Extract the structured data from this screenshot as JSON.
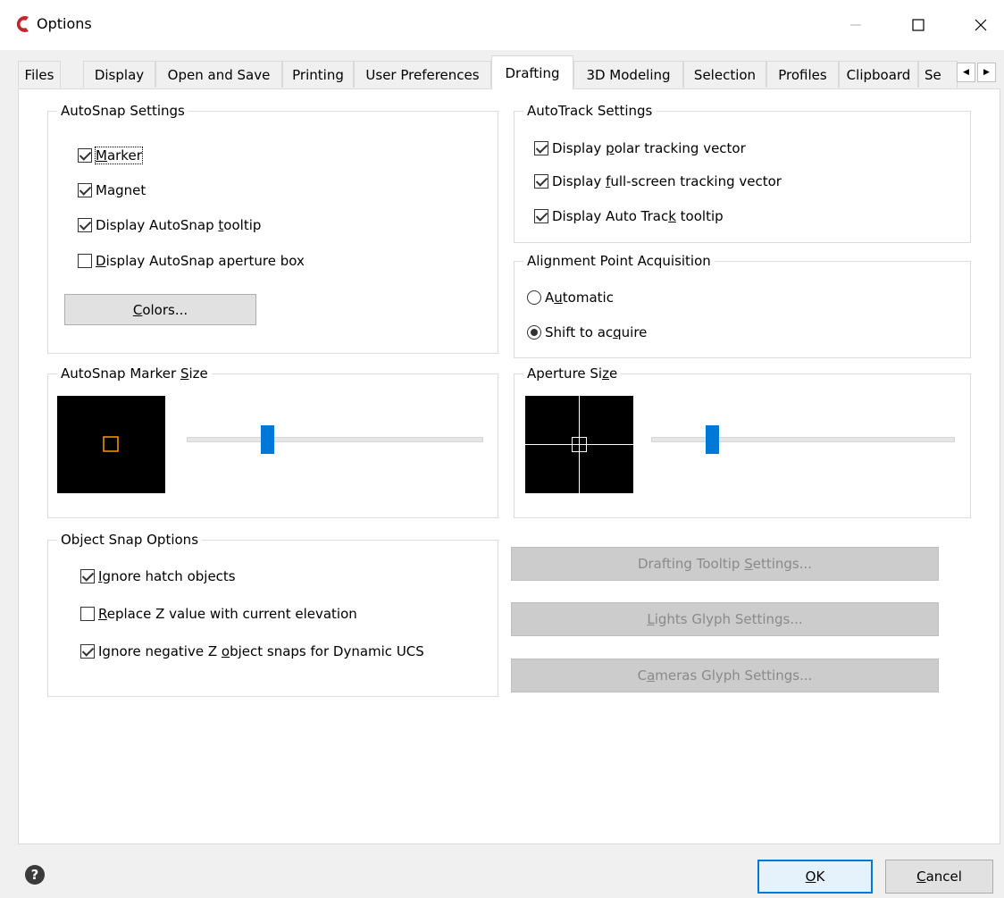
{
  "window": {
    "title": "Options",
    "minimize_icon": "minimize-icon",
    "maximize_icon": "maximize-icon",
    "close_icon": "close-icon"
  },
  "tabs": [
    {
      "label": "Files"
    },
    {
      "label": "Display"
    },
    {
      "label": "Open and Save"
    },
    {
      "label": "Printing"
    },
    {
      "label": "User Preferences"
    },
    {
      "label": "Drafting",
      "active": true
    },
    {
      "label": "3D Modeling"
    },
    {
      "label": "Selection"
    },
    {
      "label": "Profiles"
    },
    {
      "label": "Clipboard"
    },
    {
      "label": "Se"
    }
  ],
  "autosnap": {
    "title": "AutoSnap Settings",
    "marker": {
      "pre": "",
      "u": "M",
      "post": "arker",
      "checked": true
    },
    "magnet": {
      "pre": "Ma",
      "u": "g",
      "post": "net",
      "checked": true
    },
    "tooltip": {
      "pre": "Display AutoSnap ",
      "u": "t",
      "post": "ooltip",
      "checked": true
    },
    "aperture": {
      "pre": "",
      "u": "D",
      "post": "isplay AutoSnap aperture box",
      "checked": false
    },
    "colors_button": {
      "pre": "",
      "u": "C",
      "post": "olors..."
    }
  },
  "autotrack": {
    "title": "AutoTrack Settings",
    "polar": {
      "pre": "Display ",
      "u": "p",
      "post": "olar tracking vector",
      "checked": true
    },
    "fullscreen": {
      "pre": "Display ",
      "u": "f",
      "post": "ull-screen tracking vector",
      "checked": true
    },
    "tooltip": {
      "pre": "Display Auto Trac",
      "u": "k",
      "post": " tooltip",
      "checked": true
    }
  },
  "alignment": {
    "title": "Alignment Point Acquisition",
    "automatic": {
      "pre": "A",
      "u": "u",
      "post": "tomatic",
      "checked": false
    },
    "shift": {
      "pre": "Shift to ac",
      "u": "q",
      "post": "uire",
      "checked": true
    }
  },
  "marker_size": {
    "title_pre": "AutoSnap Marker ",
    "title_u": "S",
    "title_post": "ize",
    "marker_color": "#ff9900",
    "slider_level": 0.27
  },
  "aperture_size": {
    "title_pre": "Aperture Si",
    "title_u": "z",
    "title_post": "e",
    "slider_level": 0.2
  },
  "object_snap": {
    "title": "Object Snap Options",
    "hatch": {
      "pre": "",
      "u": "I",
      "post": "gnore hatch objects",
      "checked": true
    },
    "replace_z": {
      "pre": "",
      "u": "R",
      "post": "eplace Z value with current elevation",
      "checked": false
    },
    "negative_z": {
      "pre": "Ignore negative Z ",
      "u": "o",
      "post": "bject snaps for Dynamic UCS",
      "checked": true
    }
  },
  "side_buttons": {
    "drafting_tooltip": {
      "pre": "Drafting Tooltip ",
      "u": "S",
      "post": "ettings..."
    },
    "lights_glyph": {
      "pre": "",
      "u": "L",
      "post": "ights Glyph Settings..."
    },
    "cameras_glyph": {
      "pre": "C",
      "u": "a",
      "post": "meras Glyph Settings..."
    }
  },
  "footer": {
    "help_icon": "help-icon",
    "ok": {
      "pre": "",
      "u": "O",
      "post": "K"
    },
    "cancel": {
      "pre": "",
      "u": "C",
      "post": "ancel"
    }
  },
  "colors": {
    "accent": "#0078d7",
    "app_icon": "#c0272d"
  }
}
